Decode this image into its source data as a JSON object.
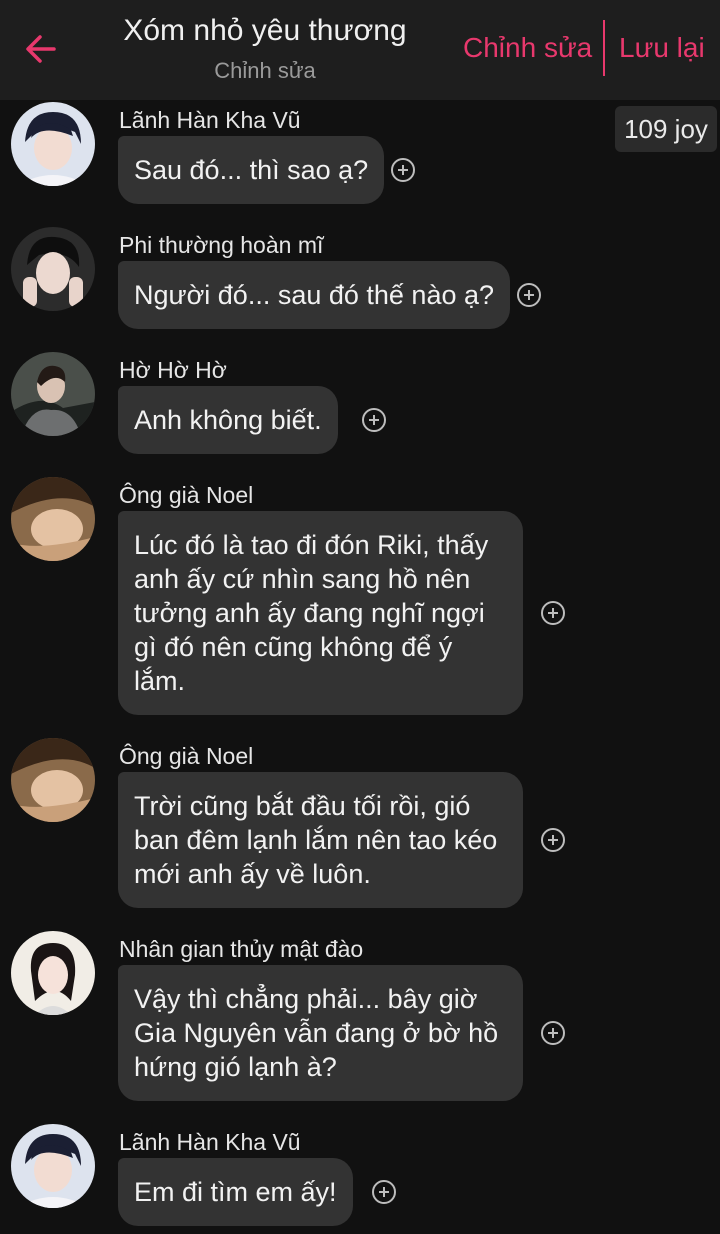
{
  "header": {
    "title": "Xóm nhỏ yêu thương",
    "subtitle": "Chỉnh sửa",
    "edit_label": "Chỉnh sửa",
    "save_label": "Lưu lại",
    "accent_color": "#e8386d"
  },
  "joy_badge": "109 joy",
  "messages": [
    {
      "sender": "Lãnh Hàn Kha Vũ",
      "text": "Sau đó... thì sao ạ?"
    },
    {
      "sender": "Phi thường hoàn mĩ",
      "text": "Người đó... sau đó thế nào ạ?"
    },
    {
      "sender": "Hờ Hờ Hờ",
      "text": "Anh không biết."
    },
    {
      "sender": "Ông già Noel",
      "text": "Lúc đó là tao đi đón Riki, thấy anh ấy cứ nhìn sang hồ nên tưởng anh ấy đang nghĩ ngợi gì đó nên cũng không để ý lắm."
    },
    {
      "sender": "Ông già Noel",
      "text": "Trời cũng bắt đầu tối rồi, gió ban đêm lạnh lắm nên tao kéo mới anh ấy về luôn."
    },
    {
      "sender": "Nhân gian thủy mật đào",
      "text": "Vậy thì chẳng phải... bây giờ Gia Nguyên vẫn đang ở bờ hồ hứng gió lạnh à?"
    },
    {
      "sender": "Lãnh Hàn Kha Vũ",
      "text": "Em đi tìm em ấy!"
    }
  ]
}
